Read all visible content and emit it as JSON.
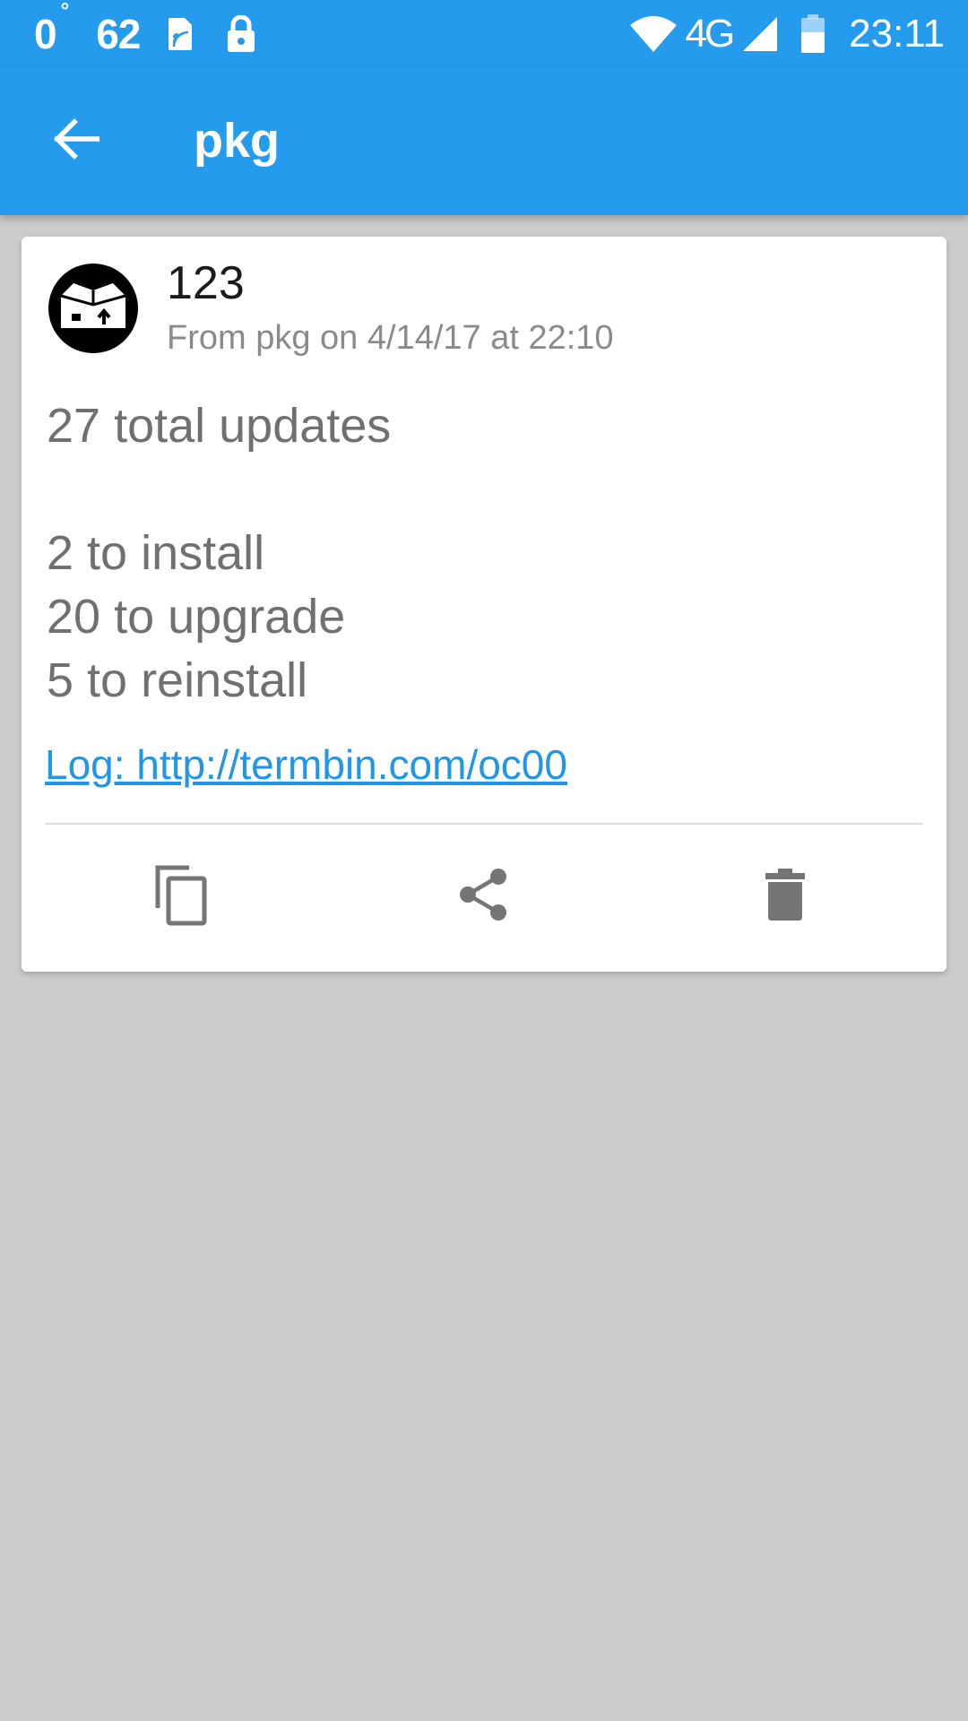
{
  "status_bar": {
    "temperature": "0",
    "temperature_unit": "°",
    "number": "62",
    "network": "4G",
    "time": "23:11",
    "icons": [
      "sim-card-icon",
      "lock-icon",
      "wifi-icon",
      "cellular-signal-icon",
      "battery-icon"
    ]
  },
  "app_bar": {
    "title": "pkg",
    "back_icon": "arrow-back-icon"
  },
  "colors": {
    "primary": "#259bed",
    "background": "#cbcbcb",
    "link": "#2196e8",
    "icon_gray": "#757575"
  },
  "card": {
    "avatar_icon": "package-box-icon",
    "title": "123",
    "subtitle": "From pkg on 4/14/17 at 22:10",
    "body_lines": [
      "27 total updates",
      "",
      "2 to install",
      "20 to upgrade",
      "5 to reinstall"
    ],
    "log_link": "Log: http://termbin.com/oc00",
    "actions": [
      {
        "name": "copy",
        "icon": "copy-icon"
      },
      {
        "name": "share",
        "icon": "share-icon"
      },
      {
        "name": "delete",
        "icon": "delete-icon"
      }
    ]
  }
}
